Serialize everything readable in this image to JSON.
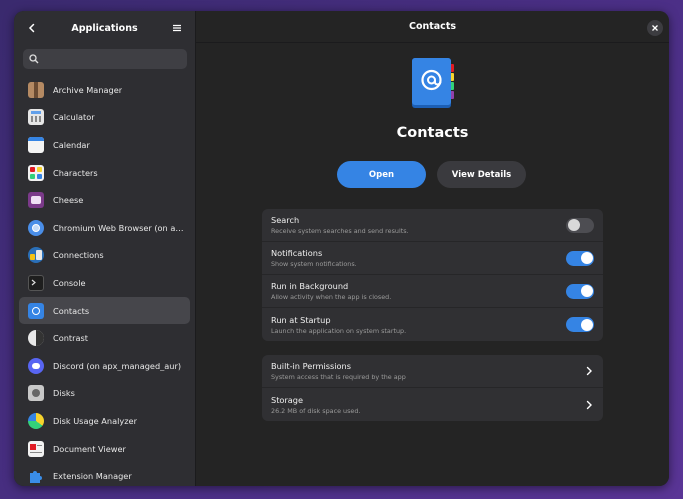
{
  "sidebar": {
    "title": "Applications",
    "search_placeholder": "",
    "items": [
      {
        "label": "Archive Manager",
        "icon": "archive-icon"
      },
      {
        "label": "Calculator",
        "icon": "calculator-icon"
      },
      {
        "label": "Calendar",
        "icon": "calendar-icon"
      },
      {
        "label": "Characters",
        "icon": "characters-icon"
      },
      {
        "label": "Cheese",
        "icon": "cheese-icon"
      },
      {
        "label": "Chromium Web Browser  (on apx_managed_aur)",
        "icon": "chromium-icon"
      },
      {
        "label": "Connections",
        "icon": "connections-icon"
      },
      {
        "label": "Console",
        "icon": "console-icon"
      },
      {
        "label": "Contacts",
        "icon": "contacts-icon"
      },
      {
        "label": "Contrast",
        "icon": "contrast-icon"
      },
      {
        "label": "Discord  (on apx_managed_aur)",
        "icon": "discord-icon"
      },
      {
        "label": "Disks",
        "icon": "disks-icon"
      },
      {
        "label": "Disk Usage Analyzer",
        "icon": "disk-usage-icon"
      },
      {
        "label": "Document Viewer",
        "icon": "document-viewer-icon"
      },
      {
        "label": "Extension Manager",
        "icon": "extension-icon"
      }
    ],
    "selected": "Contacts"
  },
  "main": {
    "title": "Contacts",
    "app_name": "Contacts",
    "open_label": "Open",
    "details_label": "View Details",
    "settings": [
      {
        "title": "Search",
        "subtitle": "Receive system searches and send results.",
        "enabled": false
      },
      {
        "title": "Notifications",
        "subtitle": "Show system notifications.",
        "enabled": true
      },
      {
        "title": "Run in Background",
        "subtitle": "Allow activity when the app is closed.",
        "enabled": true
      },
      {
        "title": "Run at Startup",
        "subtitle": "Launch the application on system startup.",
        "enabled": true
      }
    ],
    "links": [
      {
        "title": "Built-in Permissions",
        "subtitle": "System access that is required by the app"
      },
      {
        "title": "Storage",
        "subtitle": "26.2 MB of disk space used."
      }
    ]
  },
  "colors": {
    "accent": "#3584e4",
    "window_bg": "#242424",
    "sidebar_bg": "#2e2e32",
    "card_bg": "#303033"
  }
}
